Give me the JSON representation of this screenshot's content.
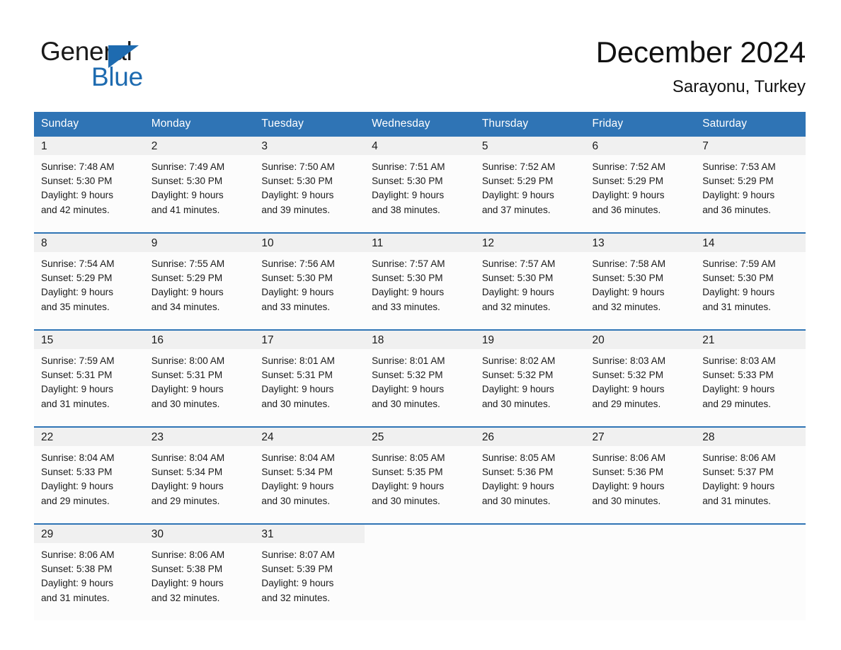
{
  "brand": {
    "name_part1": "General",
    "name_part2": "Blue",
    "logo_icon": "blue-triangle-icon"
  },
  "header": {
    "month_title": "December 2024",
    "location": "Sarayonu, Turkey"
  },
  "colors": {
    "header_blue": "#2f74b5",
    "brand_blue": "#1e6bb0",
    "daynum_band": "#f0f0f0",
    "cell_background": "#fcfcfc",
    "text": "#1a1a1a"
  },
  "calendar": {
    "weekday_headers": [
      "Sunday",
      "Monday",
      "Tuesday",
      "Wednesday",
      "Thursday",
      "Friday",
      "Saturday"
    ],
    "weeks": [
      [
        {
          "day": "1",
          "sunrise": "Sunrise: 7:48 AM",
          "sunset": "Sunset: 5:30 PM",
          "daylight1": "Daylight: 9 hours",
          "daylight2": "and 42 minutes."
        },
        {
          "day": "2",
          "sunrise": "Sunrise: 7:49 AM",
          "sunset": "Sunset: 5:30 PM",
          "daylight1": "Daylight: 9 hours",
          "daylight2": "and 41 minutes."
        },
        {
          "day": "3",
          "sunrise": "Sunrise: 7:50 AM",
          "sunset": "Sunset: 5:30 PM",
          "daylight1": "Daylight: 9 hours",
          "daylight2": "and 39 minutes."
        },
        {
          "day": "4",
          "sunrise": "Sunrise: 7:51 AM",
          "sunset": "Sunset: 5:30 PM",
          "daylight1": "Daylight: 9 hours",
          "daylight2": "and 38 minutes."
        },
        {
          "day": "5",
          "sunrise": "Sunrise: 7:52 AM",
          "sunset": "Sunset: 5:29 PM",
          "daylight1": "Daylight: 9 hours",
          "daylight2": "and 37 minutes."
        },
        {
          "day": "6",
          "sunrise": "Sunrise: 7:52 AM",
          "sunset": "Sunset: 5:29 PM",
          "daylight1": "Daylight: 9 hours",
          "daylight2": "and 36 minutes."
        },
        {
          "day": "7",
          "sunrise": "Sunrise: 7:53 AM",
          "sunset": "Sunset: 5:29 PM",
          "daylight1": "Daylight: 9 hours",
          "daylight2": "and 36 minutes."
        }
      ],
      [
        {
          "day": "8",
          "sunrise": "Sunrise: 7:54 AM",
          "sunset": "Sunset: 5:29 PM",
          "daylight1": "Daylight: 9 hours",
          "daylight2": "and 35 minutes."
        },
        {
          "day": "9",
          "sunrise": "Sunrise: 7:55 AM",
          "sunset": "Sunset: 5:29 PM",
          "daylight1": "Daylight: 9 hours",
          "daylight2": "and 34 minutes."
        },
        {
          "day": "10",
          "sunrise": "Sunrise: 7:56 AM",
          "sunset": "Sunset: 5:30 PM",
          "daylight1": "Daylight: 9 hours",
          "daylight2": "and 33 minutes."
        },
        {
          "day": "11",
          "sunrise": "Sunrise: 7:57 AM",
          "sunset": "Sunset: 5:30 PM",
          "daylight1": "Daylight: 9 hours",
          "daylight2": "and 33 minutes."
        },
        {
          "day": "12",
          "sunrise": "Sunrise: 7:57 AM",
          "sunset": "Sunset: 5:30 PM",
          "daylight1": "Daylight: 9 hours",
          "daylight2": "and 32 minutes."
        },
        {
          "day": "13",
          "sunrise": "Sunrise: 7:58 AM",
          "sunset": "Sunset: 5:30 PM",
          "daylight1": "Daylight: 9 hours",
          "daylight2": "and 32 minutes."
        },
        {
          "day": "14",
          "sunrise": "Sunrise: 7:59 AM",
          "sunset": "Sunset: 5:30 PM",
          "daylight1": "Daylight: 9 hours",
          "daylight2": "and 31 minutes."
        }
      ],
      [
        {
          "day": "15",
          "sunrise": "Sunrise: 7:59 AM",
          "sunset": "Sunset: 5:31 PM",
          "daylight1": "Daylight: 9 hours",
          "daylight2": "and 31 minutes."
        },
        {
          "day": "16",
          "sunrise": "Sunrise: 8:00 AM",
          "sunset": "Sunset: 5:31 PM",
          "daylight1": "Daylight: 9 hours",
          "daylight2": "and 30 minutes."
        },
        {
          "day": "17",
          "sunrise": "Sunrise: 8:01 AM",
          "sunset": "Sunset: 5:31 PM",
          "daylight1": "Daylight: 9 hours",
          "daylight2": "and 30 minutes."
        },
        {
          "day": "18",
          "sunrise": "Sunrise: 8:01 AM",
          "sunset": "Sunset: 5:32 PM",
          "daylight1": "Daylight: 9 hours",
          "daylight2": "and 30 minutes."
        },
        {
          "day": "19",
          "sunrise": "Sunrise: 8:02 AM",
          "sunset": "Sunset: 5:32 PM",
          "daylight1": "Daylight: 9 hours",
          "daylight2": "and 30 minutes."
        },
        {
          "day": "20",
          "sunrise": "Sunrise: 8:03 AM",
          "sunset": "Sunset: 5:32 PM",
          "daylight1": "Daylight: 9 hours",
          "daylight2": "and 29 minutes."
        },
        {
          "day": "21",
          "sunrise": "Sunrise: 8:03 AM",
          "sunset": "Sunset: 5:33 PM",
          "daylight1": "Daylight: 9 hours",
          "daylight2": "and 29 minutes."
        }
      ],
      [
        {
          "day": "22",
          "sunrise": "Sunrise: 8:04 AM",
          "sunset": "Sunset: 5:33 PM",
          "daylight1": "Daylight: 9 hours",
          "daylight2": "and 29 minutes."
        },
        {
          "day": "23",
          "sunrise": "Sunrise: 8:04 AM",
          "sunset": "Sunset: 5:34 PM",
          "daylight1": "Daylight: 9 hours",
          "daylight2": "and 29 minutes."
        },
        {
          "day": "24",
          "sunrise": "Sunrise: 8:04 AM",
          "sunset": "Sunset: 5:34 PM",
          "daylight1": "Daylight: 9 hours",
          "daylight2": "and 30 minutes."
        },
        {
          "day": "25",
          "sunrise": "Sunrise: 8:05 AM",
          "sunset": "Sunset: 5:35 PM",
          "daylight1": "Daylight: 9 hours",
          "daylight2": "and 30 minutes."
        },
        {
          "day": "26",
          "sunrise": "Sunrise: 8:05 AM",
          "sunset": "Sunset: 5:36 PM",
          "daylight1": "Daylight: 9 hours",
          "daylight2": "and 30 minutes."
        },
        {
          "day": "27",
          "sunrise": "Sunrise: 8:06 AM",
          "sunset": "Sunset: 5:36 PM",
          "daylight1": "Daylight: 9 hours",
          "daylight2": "and 30 minutes."
        },
        {
          "day": "28",
          "sunrise": "Sunrise: 8:06 AM",
          "sunset": "Sunset: 5:37 PM",
          "daylight1": "Daylight: 9 hours",
          "daylight2": "and 31 minutes."
        }
      ],
      [
        {
          "day": "29",
          "sunrise": "Sunrise: 8:06 AM",
          "sunset": "Sunset: 5:38 PM",
          "daylight1": "Daylight: 9 hours",
          "daylight2": "and 31 minutes."
        },
        {
          "day": "30",
          "sunrise": "Sunrise: 8:06 AM",
          "sunset": "Sunset: 5:38 PM",
          "daylight1": "Daylight: 9 hours",
          "daylight2": "and 32 minutes."
        },
        {
          "day": "31",
          "sunrise": "Sunrise: 8:07 AM",
          "sunset": "Sunset: 5:39 PM",
          "daylight1": "Daylight: 9 hours",
          "daylight2": "and 32 minutes."
        },
        {
          "day": "",
          "sunrise": "",
          "sunset": "",
          "daylight1": "",
          "daylight2": ""
        },
        {
          "day": "",
          "sunrise": "",
          "sunset": "",
          "daylight1": "",
          "daylight2": ""
        },
        {
          "day": "",
          "sunrise": "",
          "sunset": "",
          "daylight1": "",
          "daylight2": ""
        },
        {
          "day": "",
          "sunrise": "",
          "sunset": "",
          "daylight1": "",
          "daylight2": ""
        }
      ]
    ]
  }
}
